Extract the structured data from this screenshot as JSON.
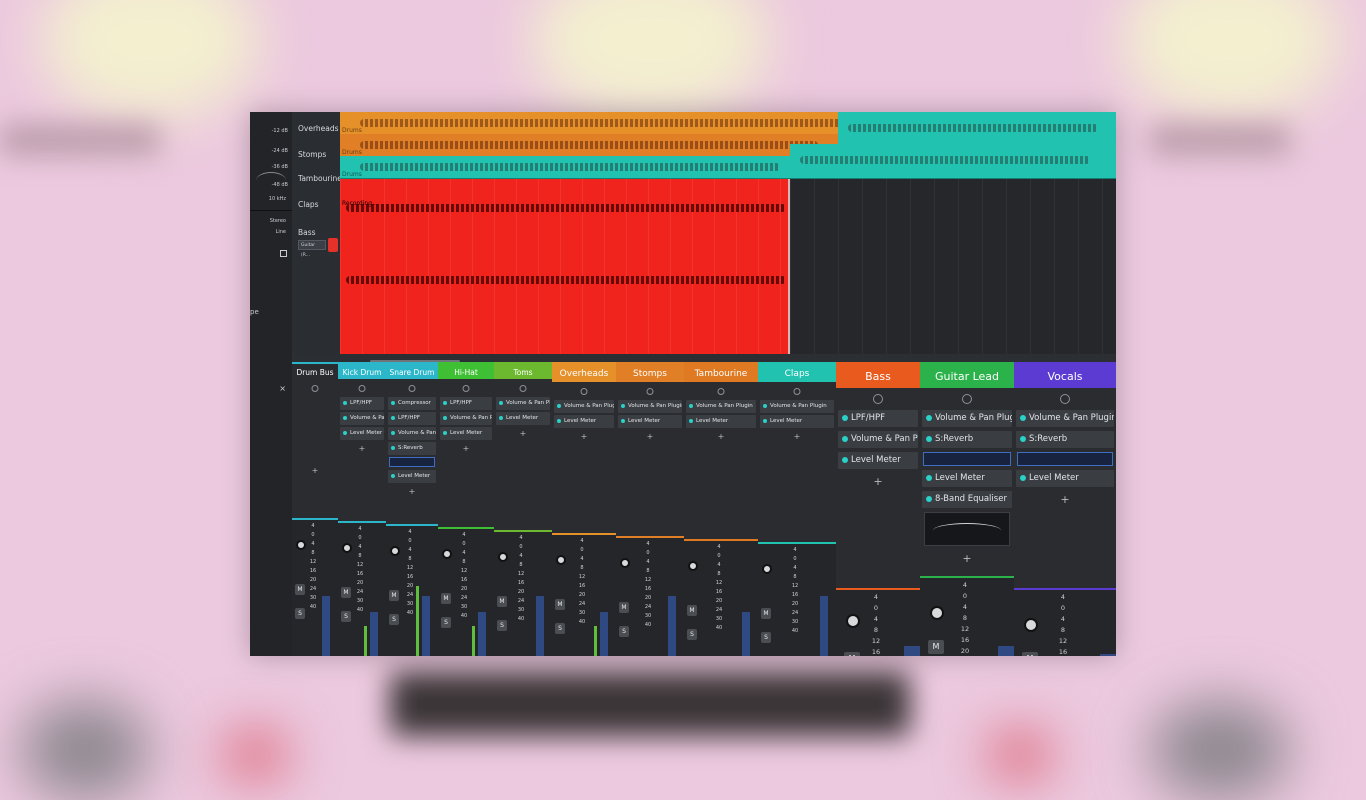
{
  "inspector": {
    "db_labels": [
      "-12 dB",
      "-24 dB",
      "-36 dB",
      "-48 dB"
    ],
    "freq_label": "10 kHz",
    "stereo_label": "Stereo",
    "line_label": "Line",
    "type_fragment": "pe",
    "close_symbol": "×"
  },
  "arrange": {
    "tracks": [
      {
        "name": "Overheads",
        "lane_tag": "Drums",
        "color": "#e6902a"
      },
      {
        "name": "Stomps",
        "lane_tag": "Drums",
        "color": "#e07f25"
      },
      {
        "name": "Tambourine",
        "lane_tag": "Drums",
        "color": "#e07a22"
      },
      {
        "name": "Claps",
        "lane_tag": "Drums",
        "color": "#21c2b0"
      },
      {
        "name": "Bass",
        "lane_tag": "",
        "color": "#f0231d"
      }
    ],
    "bass_input": "Guitar (R...",
    "recording_label": "Recording..."
  },
  "mixer": {
    "strips": [
      {
        "name": "Drum Bus",
        "color": "#2bb7c9",
        "plugins": []
      },
      {
        "name": "Kick Drum",
        "color": "#2bb7c9",
        "plugins": [
          "LPF/HPF",
          "Volume & Pan Plugin",
          "Level Meter"
        ]
      },
      {
        "name": "Snare Drum",
        "color": "#2bb7c9",
        "plugins": [
          "Compressor",
          "LPF/HPF",
          "Volume & Pan Plugin",
          "S:Reverb",
          "Level Meter"
        ]
      },
      {
        "name": "Hi-Hat",
        "color": "#3fbf34",
        "plugins": [
          "LPF/HPF",
          "Volume & Pan Plugin",
          "Level Meter"
        ]
      },
      {
        "name": "Toms",
        "color": "#6cb82f",
        "plugins": [
          "Volume & Pan Plugin",
          "Level Meter"
        ]
      },
      {
        "name": "Overheads",
        "color": "#e6902a",
        "plugins": [
          "Volume & Pan Plugin",
          "Level Meter"
        ]
      },
      {
        "name": "Stomps",
        "color": "#e07f25",
        "plugins": [
          "Volume & Pan Plugin",
          "Level Meter"
        ]
      },
      {
        "name": "Tambourine",
        "color": "#e07a22",
        "plugins": [
          "Volume & Pan Plugin",
          "Level Meter"
        ]
      },
      {
        "name": "Claps",
        "color": "#21c2b0",
        "plugins": [
          "Volume & Pan Plugin",
          "Level Meter"
        ]
      },
      {
        "name": "Bass",
        "color": "#e85a1e",
        "plugins": [
          "LPF/HPF",
          "Volume & Pan Plugin",
          "Level Meter"
        ]
      },
      {
        "name": "Guitar Lead",
        "color": "#2bb24a",
        "plugins": [
          "Volume & Pan Plugin",
          "S:Reverb",
          "Level Meter",
          "8-Band Equaliser"
        ]
      },
      {
        "name": "Vocals",
        "color": "#5b3bd1",
        "plugins": [
          "Volume & Pan Plugin",
          "S:Reverb",
          "Level Meter"
        ]
      }
    ],
    "add_symbol": "+",
    "mute_label": "M",
    "solo_label": "S",
    "scale_values": [
      "4",
      "0",
      "4",
      "8",
      "12",
      "16",
      "20",
      "24",
      "30",
      "40"
    ]
  },
  "theme": {
    "background": "#ecc9df",
    "record_red": "#f0231d",
    "plugin_led": "#29d1c8"
  }
}
